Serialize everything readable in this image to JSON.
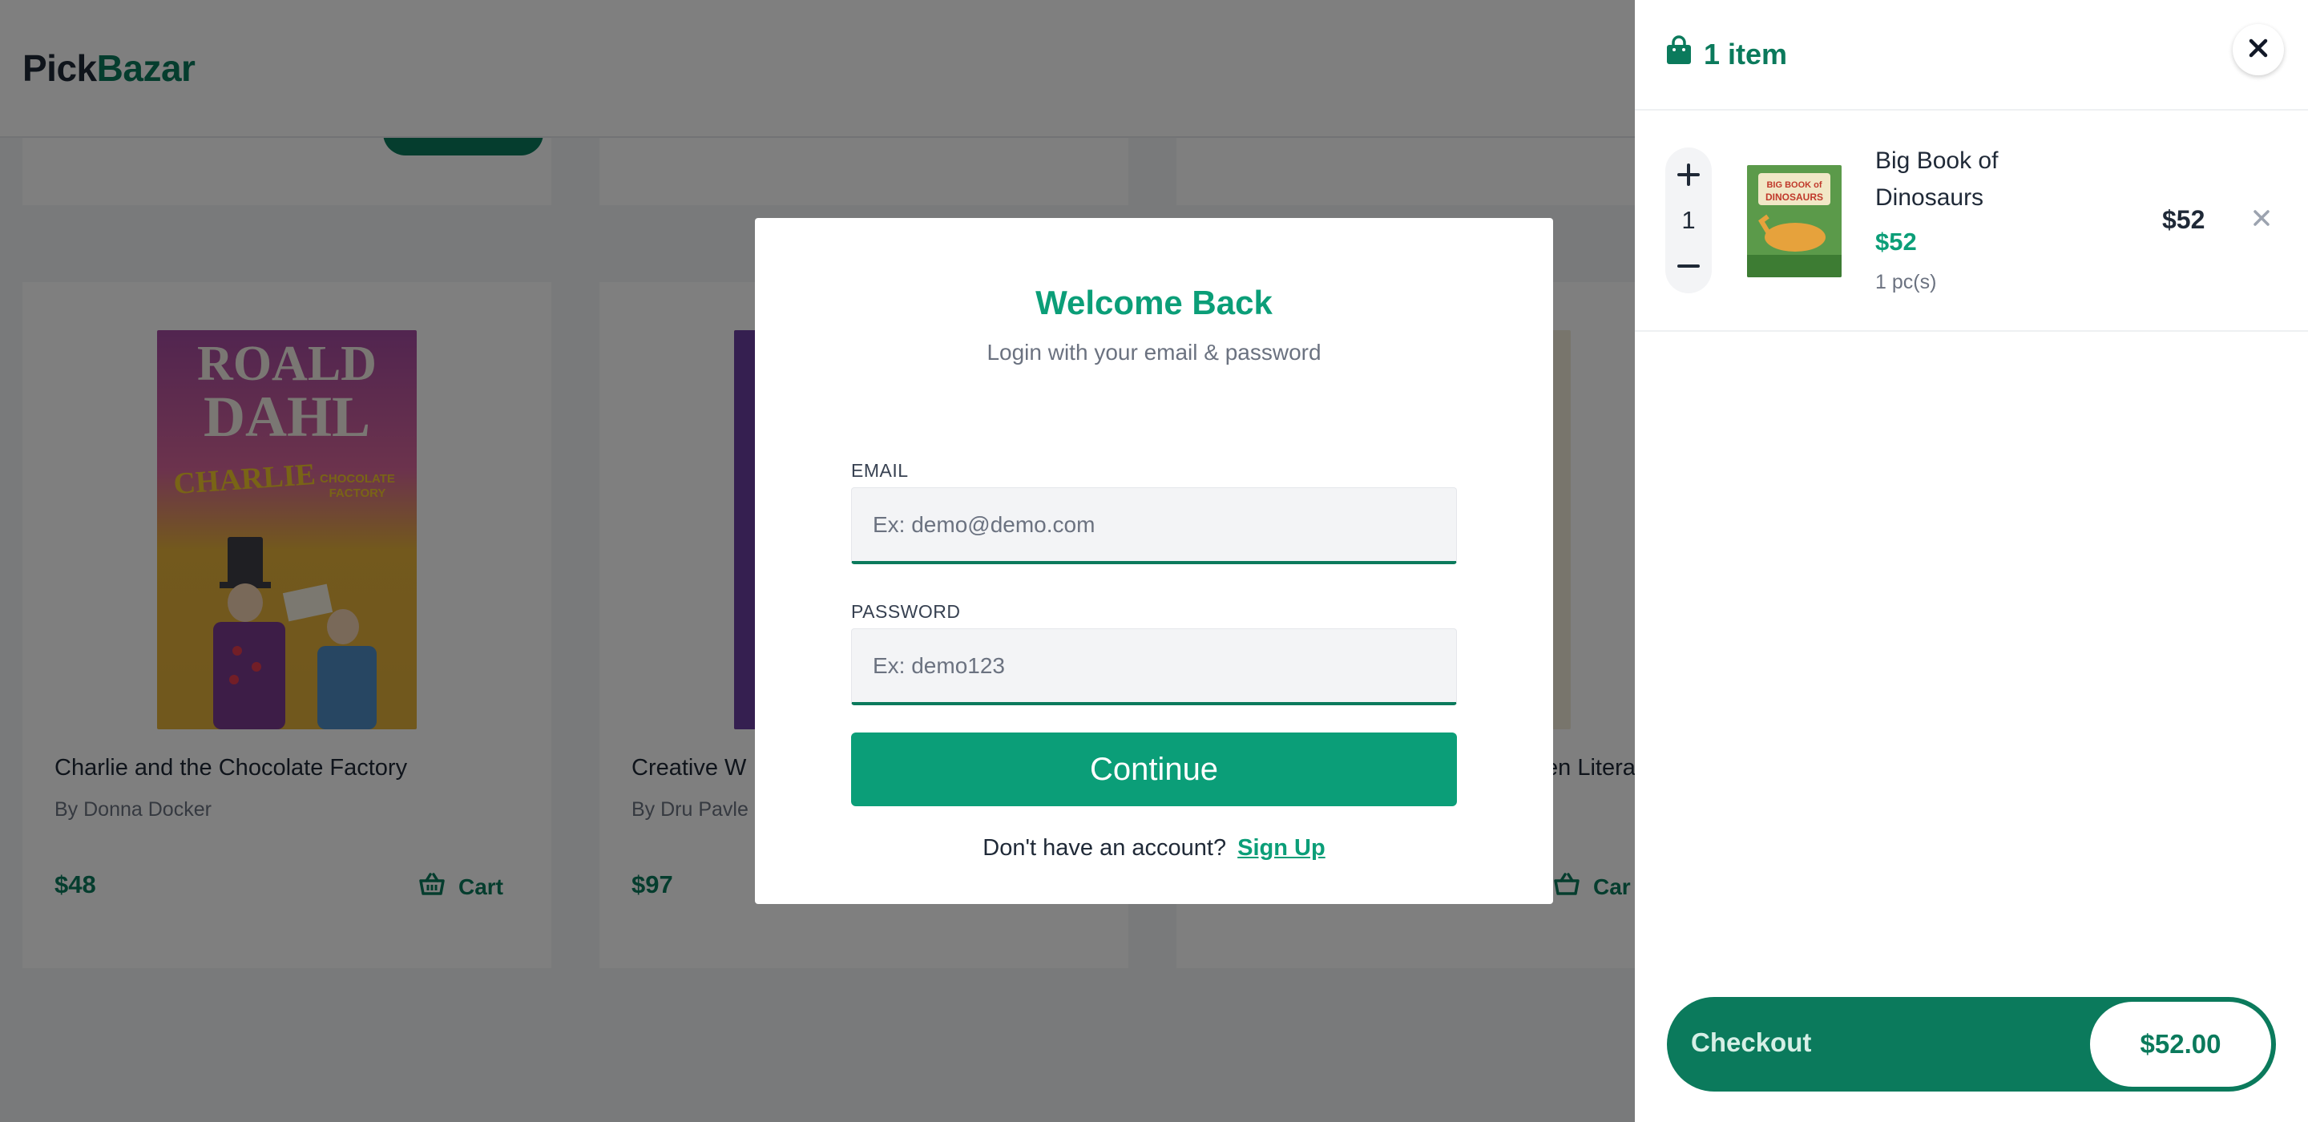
{
  "app": {
    "logo_part1": "Pick",
    "logo_part2": "Bazar"
  },
  "products": [
    {
      "title": "Charlie and the Chocolate Factory",
      "author": "By Donna Docker",
      "price": "$48",
      "cart_label": "Cart",
      "cover_text_1": "ROALD",
      "cover_text_2": "DAHL",
      "cover_text_3": "CHARLIE"
    },
    {
      "title": "Creative W",
      "author": "By Dru Pavle",
      "price": "$97"
    },
    {
      "title": "en Litera",
      "cart_label": "Car"
    }
  ],
  "modal": {
    "title": "Welcome Back",
    "subtitle": "Login with your email & password",
    "email_label": "EMAIL",
    "email_placeholder": "Ex: demo@demo.com",
    "password_label": "PASSWORD",
    "password_placeholder": "Ex: demo123",
    "continue_label": "Continue",
    "signup_prompt": "Don't have an account?",
    "signup_link": "Sign Up"
  },
  "cart": {
    "count_label": "1 item",
    "items": [
      {
        "name": "Big Book of Dinosaurs",
        "unit_price": "$52",
        "quantity": "1",
        "pcs": "1 pc(s)",
        "total": "$52",
        "thumb_text": "BIG BOOK of DINOSAURS"
      }
    ],
    "checkout_label": "Checkout",
    "checkout_total": "$52.00"
  },
  "colors": {
    "brand": "#0b7a5c",
    "accent": "#0b9e78"
  },
  "icons": {
    "bag": "shopping-bag-icon",
    "close": "close-icon",
    "plus": "plus-icon",
    "minus": "minus-icon",
    "remove": "remove-icon",
    "basket": "basket-icon"
  }
}
